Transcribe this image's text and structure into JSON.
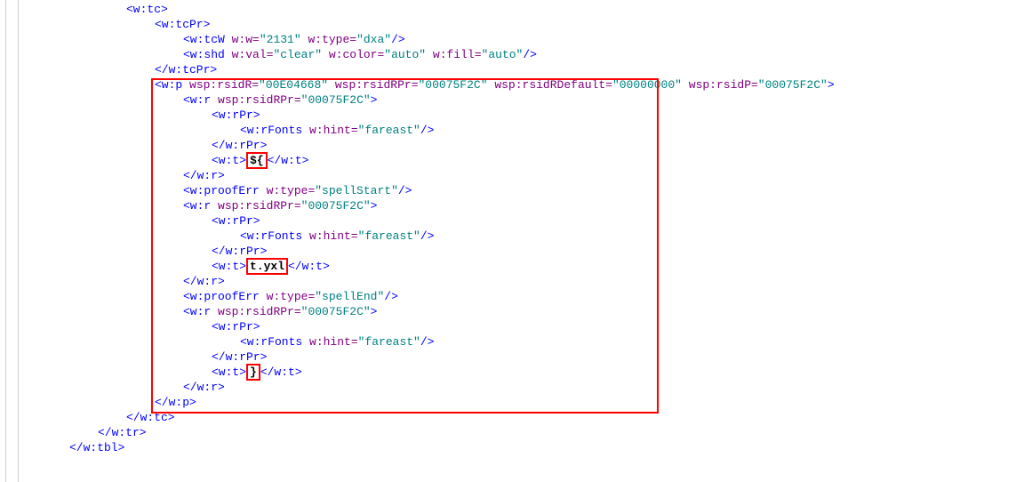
{
  "lines": {
    "l1_open": "<w:tc>",
    "l2_open": "<w:tcPr>",
    "l3_tcw": "<w:tcW",
    "l3_attr1n": "w:w=",
    "l3_attr1v": "\"2131\"",
    "l3_attr2n": "w:type=",
    "l3_attr2v": "\"dxa\"",
    "l3_close": "/>",
    "l4_shd": "<w:shd",
    "l4_a1n": "w:val=",
    "l4_a1v": "\"clear\"",
    "l4_a2n": "w:color=",
    "l4_a2v": "\"auto\"",
    "l4_a3n": "w:fill=",
    "l4_a3v": "\"auto\"",
    "l4_close": "/>",
    "l5_close": "</w:tcPr>",
    "l6_open": "<w:p",
    "l6_a1n": "wsp:rsidR=",
    "l6_a1v": "\"00E04668\"",
    "l6_a2n": "wsp:rsidRPr=",
    "l6_a2v": "\"00075F2C\"",
    "l6_a3n": "wsp:rsidRDefault=",
    "l6_a3v": "\"00000000\"",
    "l6_a4n": "wsp:rsidP=",
    "l6_a4v": "\"00075F2C\"",
    "l6_end": ">",
    "l7_open": "<w:r",
    "l7_a1n": "wsp:rsidRPr=",
    "l7_a1v": "\"00075F2C\"",
    "l7_end": ">",
    "l8_open": "<w:rPr>",
    "l9_open": "<w:rFonts",
    "l9_a1n": "w:hint=",
    "l9_a1v": "\"fareast\"",
    "l9_close": "/>",
    "l10_close": "</w:rPr>",
    "l11_open": "<w:t>",
    "l11_txt": "${",
    "l11_close": "</w:t>",
    "l12_close": "</w:r>",
    "l13_open": "<w:proofErr",
    "l13_a1n": "w:type=",
    "l13_a1v": "\"spellStart\"",
    "l13_close": "/>",
    "l14_open": "<w:r",
    "l14_a1n": "wsp:rsidRPr=",
    "l14_a1v": "\"00075F2C\"",
    "l14_end": ">",
    "l15_open": "<w:rPr>",
    "l16_open": "<w:rFonts",
    "l16_a1n": "w:hint=",
    "l16_a1v": "\"fareast\"",
    "l16_close": "/>",
    "l17_close": "</w:rPr>",
    "l18_open": "<w:t>",
    "l18_txt": "t.yxl",
    "l18_close": "</w:t>",
    "l19_close": "</w:r>",
    "l20_open": "<w:proofErr",
    "l20_a1n": "w:type=",
    "l20_a1v": "\"spellEnd\"",
    "l20_close": "/>",
    "l21_open": "<w:r",
    "l21_a1n": "wsp:rsidRPr=",
    "l21_a1v": "\"00075F2C\"",
    "l21_end": ">",
    "l22_open": "<w:rPr>",
    "l23_open": "<w:rFonts",
    "l23_a1n": "w:hint=",
    "l23_a1v": "\"fareast\"",
    "l23_close": "/>",
    "l24_close": "</w:rPr>",
    "l25_open": "<w:t>",
    "l25_txt": "}",
    "l25_close": "</w:t>",
    "l26_close": "</w:r>",
    "l27_close": "</w:p>",
    "l28_close": "</w:tc>",
    "l29_close": "</w:tr>",
    "l30_close": "</w:tbl>"
  }
}
